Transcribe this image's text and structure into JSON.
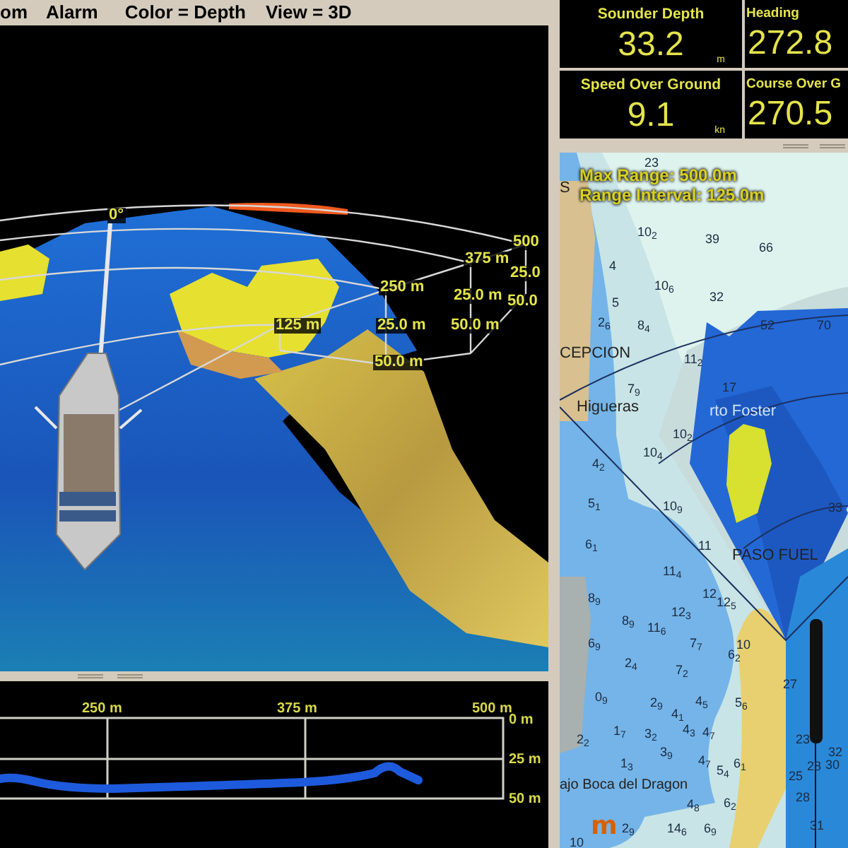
{
  "menu": [
    "om",
    "Alarm",
    "Color = Depth",
    "View = 3D"
  ],
  "view_3d": {
    "labels": [
      "0°",
      "500",
      "375 m",
      "25.0",
      "250 m",
      "25.0 m",
      "50.0",
      "125 m",
      "25.0 m",
      "50.0 m",
      "50.0 m"
    ]
  },
  "profile": {
    "x_labels": [
      "250 m",
      "375 m",
      "500 m"
    ],
    "y_labels": [
      "0 m",
      "25 m",
      "50 m"
    ]
  },
  "instruments": [
    {
      "title": "Sounder Depth",
      "value": "33.2",
      "unit": "m"
    },
    {
      "title": "Heading",
      "value": "272.8"
    },
    {
      "title": "Speed Over Ground",
      "value": "9.1",
      "unit": "kn"
    },
    {
      "title": "Course Over G",
      "value": "270.5"
    }
  ],
  "chart": {
    "range_info": [
      "Max Range: 500.0m",
      "Range Interval: 125.0m"
    ],
    "place_names": [
      "S",
      "CEPCION",
      "Higueras",
      "rto Foster",
      "PASO FUEL",
      "ajo Boca del Dragon"
    ],
    "soundings": [
      "23",
      "10$_{2}$",
      "39",
      "66",
      "4",
      "10$_{6}$",
      "32",
      "5",
      "2$_{6}$",
      "8$_{4}$",
      "52",
      "70",
      "11$_{2}$",
      "7$_{9}$",
      "17",
      "10$_{2}$",
      "10$_{4}$",
      "4$_{2}$",
      "5$_{1}$",
      "10$_{9}$",
      "6$_{1}$",
      "11",
      "11$_{4}$",
      "12",
      "8$_{9}$",
      "12$_{5}$",
      "12$_{3}$",
      "8$_{9}$",
      "11$_{6}$",
      "6$_{9}$",
      "7$_{7}$",
      "10",
      "2$_{4}$",
      "6$_{2}$",
      "7$_{2}$",
      "0$_{9}$",
      "2$_{9}$",
      "4$_{5}$",
      "4$_{1}$",
      "5$_{6}$",
      "1$_{7}$",
      "3$_{2}$",
      "4$_{3}$",
      "4$_{7}$",
      "2$_{2}$",
      "3$_{9}$",
      "1$_{3}$",
      "4$_{7}$",
      "6$_{1}$",
      "5$_{4}$",
      "4$_{8}$",
      "6$_{2}$",
      "2$_{9}$",
      "14$_{6}$",
      "6$_{9}$",
      "10",
      "27",
      "23",
      "28",
      "30",
      "25",
      "28",
      "31",
      "33",
      "32"
    ],
    "logo": "m"
  }
}
